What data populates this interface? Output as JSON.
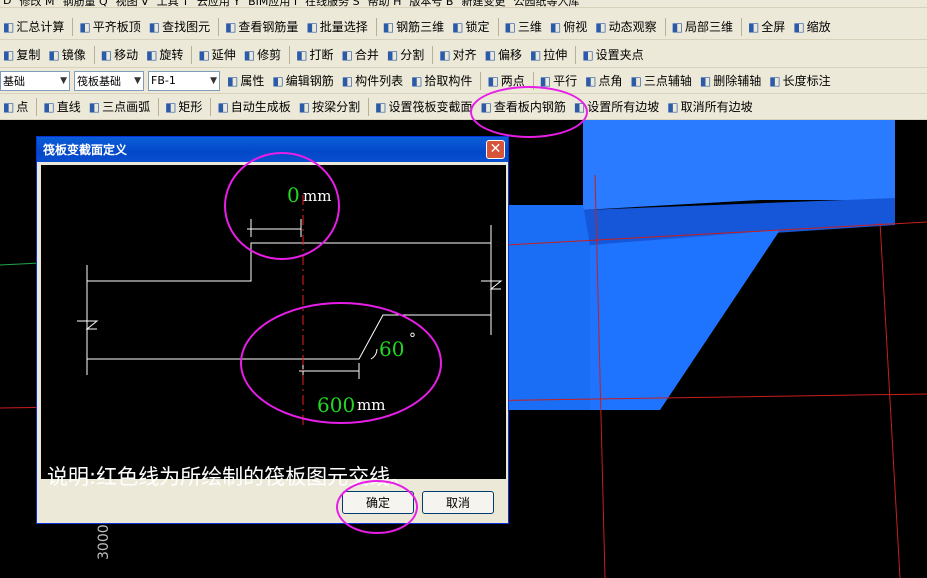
{
  "menubar": {
    "items": [
      "D",
      "修改 M",
      "钢筋量 Q",
      "视图 V",
      "工具 T",
      "云应用 Y",
      "BIM应用 I",
      "在线服务 S",
      "帮助 H",
      "版本号 B",
      "新建变更"
    ],
    "right_text": "公园纸等入库"
  },
  "toolbar1": {
    "items": [
      {
        "icon": "calc-icon",
        "label": "汇总计算"
      },
      {
        "icon": "flat-slab-icon",
        "label": "平齐板顶"
      },
      {
        "icon": "find-icon",
        "label": "查找图元"
      },
      {
        "icon": "rebar-view-icon",
        "label": "查看钢筋量"
      },
      {
        "icon": "batch-select-icon",
        "label": "批量选择"
      },
      {
        "icon": "rebar-3d-icon",
        "label": "钢筋三维"
      },
      {
        "icon": "lock-icon",
        "label": "锁定"
      },
      {
        "icon": "cube-3d-icon",
        "label": "三维"
      },
      {
        "icon": "top-view-icon",
        "label": "俯视"
      },
      {
        "icon": "orbit-icon",
        "label": "动态观察"
      },
      {
        "icon": "local-3d-icon",
        "label": "局部三维"
      },
      {
        "icon": "fullscreen-icon",
        "label": "全屏"
      },
      {
        "icon": "zoom-icon",
        "label": "缩放"
      }
    ],
    "overflow": "»"
  },
  "toolbar2": {
    "items": [
      {
        "icon": "copy-icon",
        "label": "复制"
      },
      {
        "icon": "mirror-icon",
        "label": "镜像"
      },
      {
        "icon": "move-icon",
        "label": "移动"
      },
      {
        "icon": "rotate-icon",
        "label": "旋转"
      },
      {
        "icon": "extend-icon",
        "label": "延伸"
      },
      {
        "icon": "trim-icon",
        "label": "修剪"
      },
      {
        "icon": "break-icon",
        "label": "打断"
      },
      {
        "icon": "merge-icon",
        "label": "合并"
      },
      {
        "icon": "split-icon",
        "label": "分割"
      },
      {
        "icon": "align-icon",
        "label": "对齐"
      },
      {
        "icon": "offset-icon",
        "label": "偏移"
      },
      {
        "icon": "stretch-icon",
        "label": "拉伸"
      },
      {
        "icon": "grip-icon",
        "label": "设置夹点"
      }
    ]
  },
  "toolbar3": {
    "combo_layer": "基础",
    "combo_type": "筏板基础",
    "combo_name": "FB-1",
    "items": [
      {
        "icon": "property-icon",
        "label": "属性"
      },
      {
        "icon": "edit-rebar-icon",
        "label": "编辑钢筋"
      },
      {
        "icon": "list-icon",
        "label": "构件列表"
      },
      {
        "icon": "pick-icon",
        "label": "拾取构件"
      },
      {
        "icon": "two-point-icon",
        "label": "两点"
      },
      {
        "icon": "parallel-icon",
        "label": "平行"
      },
      {
        "icon": "point-angle-icon",
        "label": "点角"
      },
      {
        "icon": "three-point-axis-icon",
        "label": "三点辅轴"
      },
      {
        "icon": "delete-axis-icon",
        "label": "删除辅轴"
      },
      {
        "icon": "dimension-icon",
        "label": "长度标注"
      }
    ]
  },
  "toolbar4": {
    "items": [
      {
        "icon": "point-icon",
        "label": "点"
      },
      {
        "icon": "line-icon",
        "label": "直线"
      },
      {
        "icon": "arc-icon",
        "label": "三点画弧"
      },
      {
        "icon": "rect-icon",
        "label": "矩形"
      },
      {
        "icon": "auto-slab-icon",
        "label": "自动生成板"
      },
      {
        "icon": "beam-split-icon",
        "label": "按梁分割"
      },
      {
        "icon": "section-icon",
        "label": "设置筏板变截面"
      },
      {
        "icon": "inner-rebar-icon",
        "label": "查看板内钢筋"
      },
      {
        "icon": "set-slope-icon",
        "label": "设置所有边坡"
      },
      {
        "icon": "cancel-slope-icon",
        "label": "取消所有边坡"
      }
    ]
  },
  "dialog": {
    "title": "筏板变截面定义",
    "close_glyph": "✕",
    "top_value": "0",
    "top_unit": "mm",
    "bottom_value": "600",
    "bottom_unit": "mm",
    "angle_value": "60",
    "angle_unit": "°",
    "explanation": "说明:红色线为所绘制的筏板图元交线。",
    "ok_label": "确定",
    "cancel_label": "取消"
  },
  "viewport": {
    "axis_label": "3000"
  },
  "colors": {
    "toolbar_bg": "#ece9d8",
    "dialog_title": "#0a5fd8",
    "slab_blue": "#1a6ef5",
    "grid_red": "#c81e1e",
    "highlight": "#e61ee6",
    "value_green": "#23d623"
  }
}
